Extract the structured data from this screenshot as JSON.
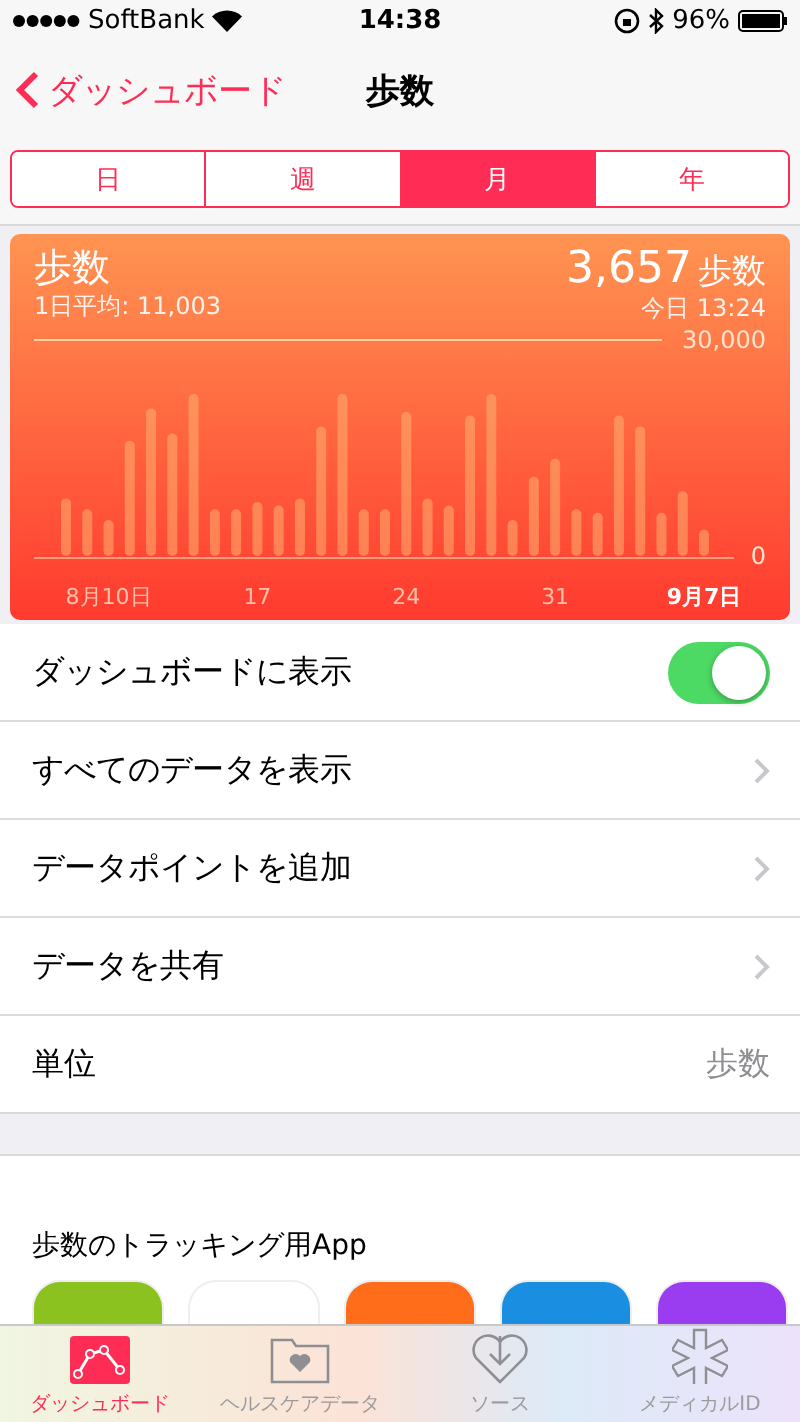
{
  "status_bar": {
    "carrier": "SoftBank",
    "time": "14:38",
    "battery": "96%"
  },
  "nav": {
    "back": "ダッシュボード",
    "title": "歩数"
  },
  "segments": [
    {
      "label": "日",
      "selected": false
    },
    {
      "label": "週",
      "selected": false
    },
    {
      "label": "月",
      "selected": true
    },
    {
      "label": "年",
      "selected": false
    }
  ],
  "summary": {
    "title": "歩数",
    "average": "1日平均: 11,003",
    "total": "3,657",
    "unit": "歩数",
    "updated": "今日 13:24",
    "chart_data": {
      "type": "bar",
      "ylim": [
        0,
        30000
      ],
      "yticks": [
        {
          "value": 0,
          "label": "0"
        },
        {
          "value": 30000,
          "label": "30,000"
        }
      ],
      "categories": [
        null,
        null,
        "8月10日",
        null,
        null,
        null,
        null,
        null,
        null,
        "17",
        null,
        null,
        null,
        null,
        null,
        null,
        "24",
        null,
        null,
        null,
        null,
        null,
        null,
        "31",
        null,
        null,
        null,
        null,
        null,
        null,
        "9月7日"
      ],
      "values": [
        8000,
        6500,
        5000,
        16000,
        20500,
        17000,
        22500,
        6500,
        6500,
        7500,
        7000,
        8000,
        18000,
        22500,
        6500,
        6500,
        20000,
        8000,
        7000,
        19500,
        22500,
        5000,
        11000,
        13500,
        6500,
        6000,
        19500,
        18000,
        6000,
        9000,
        3657
      ]
    }
  },
  "rows": [
    {
      "kind": "toggle",
      "label": "ダッシュボードに表示",
      "on": true
    },
    {
      "kind": "link",
      "label": "すべてのデータを表示"
    },
    {
      "kind": "link",
      "label": "データポイントを追加"
    },
    {
      "kind": "link",
      "label": "データを共有"
    },
    {
      "kind": "value",
      "label": "単位",
      "value": "歩数"
    }
  ],
  "apps_section": {
    "heading": "歩数のトラッキング用App",
    "apps": [
      {
        "color": "#8cc21f"
      },
      {
        "color": "#ffffff"
      },
      {
        "color": "#ff6d1a"
      },
      {
        "color": "#1a8ee0"
      },
      {
        "color": "#9a3cf0"
      }
    ]
  },
  "tab_bar": [
    {
      "label": "ダッシュボード",
      "selected": true
    },
    {
      "label": "ヘルスケアデータ",
      "selected": false
    },
    {
      "label": "ソース",
      "selected": false
    },
    {
      "label": "メディカルID",
      "selected": false
    }
  ]
}
